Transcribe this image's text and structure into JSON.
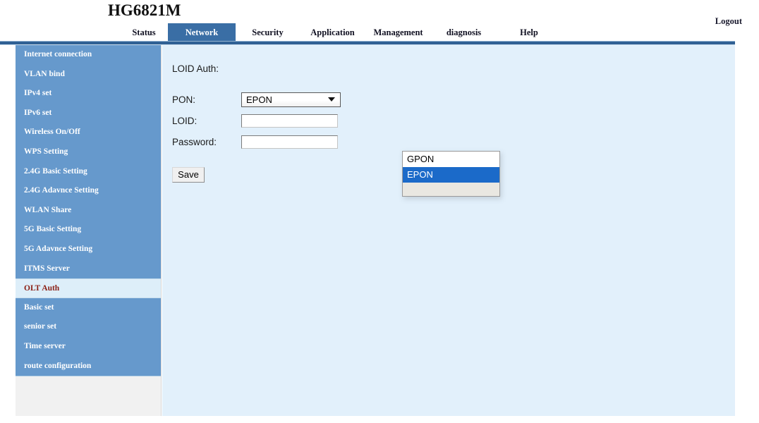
{
  "header": {
    "brand_title": "HG6821M",
    "logout_label": "Logout"
  },
  "nav": {
    "active_tab": "Network",
    "tabs": [
      {
        "label": "Status"
      },
      {
        "label": "Network"
      },
      {
        "label": "Security"
      },
      {
        "label": "Application"
      },
      {
        "label": "Management"
      },
      {
        "label": "diagnosis"
      },
      {
        "label": "Help"
      }
    ]
  },
  "sidebar": {
    "active_item": "OLT Auth",
    "items": [
      {
        "label": "Internet connection"
      },
      {
        "label": "VLAN bind"
      },
      {
        "label": "IPv4 set"
      },
      {
        "label": "IPv6 set"
      },
      {
        "label": "Wireless On/Off"
      },
      {
        "label": "WPS Setting"
      },
      {
        "label": "2.4G Basic Setting"
      },
      {
        "label": "2.4G Adavnce Setting"
      },
      {
        "label": "WLAN Share"
      },
      {
        "label": "5G Basic Setting"
      },
      {
        "label": "5G Adavnce Setting"
      },
      {
        "label": "ITMS Server"
      },
      {
        "label": "OLT Auth"
      },
      {
        "label": "Basic set"
      },
      {
        "label": "senior set"
      },
      {
        "label": "Time server"
      },
      {
        "label": "route configuration"
      }
    ]
  },
  "main": {
    "form_title": "LOID Auth:",
    "fields": {
      "pon_label": "PON:",
      "pon_value": "EPON",
      "loid_label": "LOID:",
      "loid_value": "",
      "password_label": "Password:",
      "password_value": ""
    },
    "pon_dropdown": {
      "open": true,
      "options": [
        {
          "label": "GPON",
          "selected": false
        },
        {
          "label": "EPON",
          "selected": true
        }
      ]
    },
    "save_label": "Save"
  },
  "colors": {
    "accent_blue": "#3a6ea5",
    "sidebar_blue": "#6699cc",
    "panel_bg": "#e2f0fb",
    "rule_blue": "#2f6094",
    "active_item_text": "#8b2015",
    "dropdown_highlight": "#1b6ac9"
  },
  "icons": {
    "select_arrow": "chevron-down-icon"
  }
}
